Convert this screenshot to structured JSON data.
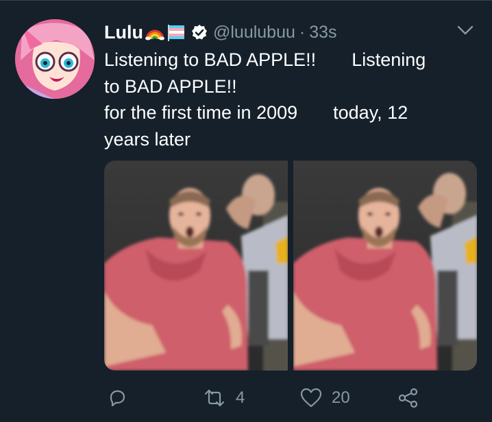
{
  "tweet": {
    "display_name": "Lulu",
    "name_emojis": [
      "rainbow-emoji",
      "flag-emoji"
    ],
    "verified": true,
    "handle": "@luulubuu",
    "separator": "·",
    "timestamp": "33s",
    "text_lines": [
      [
        "Listening to BAD APPLE!!",
        "Listening"
      ],
      [
        "to BAD APPLE!!"
      ],
      [
        "for the first time in 2009",
        "today, 12"
      ],
      [
        "years later"
      ]
    ]
  },
  "media": {
    "photos": [
      {
        "description": "man-reacting-gif-frame-1"
      },
      {
        "description": "man-reacting-gif-frame-2"
      }
    ]
  },
  "actions": {
    "reply": {
      "icon": "reply-icon",
      "count": ""
    },
    "retweet": {
      "icon": "retweet-icon",
      "count": "4"
    },
    "like": {
      "icon": "heart-icon",
      "count": "20"
    },
    "share": {
      "icon": "share-icon",
      "count": ""
    }
  },
  "colors": {
    "background": "#15202b",
    "text": "#ffffff",
    "secondary_text": "#8899a6",
    "verified_badge": "#ffffff"
  }
}
